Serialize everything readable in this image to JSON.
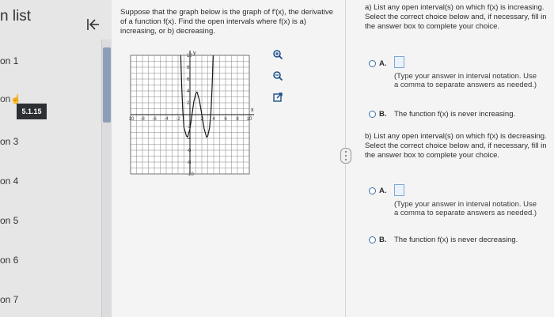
{
  "sidebar": {
    "heading": "n list",
    "items": [
      {
        "label": "on 1"
      },
      {
        "label": "on 3"
      },
      {
        "label": "on 4"
      },
      {
        "label": "on 5"
      },
      {
        "label": "on 6"
      },
      {
        "label": "on 7"
      }
    ],
    "current_prefix": "on",
    "current_badge": "5.1.15",
    "collapse_icon": "collapse-left-icon"
  },
  "question": {
    "text": "Suppose that the graph below is the graph of f′(x), the derivative of a function f(x). Find the open intervals where f(x) is a) increasing, or b) decreasing."
  },
  "graph": {
    "x_label": "x",
    "y_label": "y",
    "x_ticks": [
      "-10",
      "-8",
      "-6",
      "-4",
      "-2",
      "2",
      "4",
      "6",
      "8",
      "10"
    ],
    "y_ticks": [
      "10",
      "8",
      "6",
      "4",
      "2",
      "-2",
      "-4",
      "-6",
      "-8",
      "-10"
    ],
    "xlim": [
      -10,
      10
    ],
    "ylim": [
      -10,
      10
    ],
    "curve": [
      [
        -1.55,
        10
      ],
      [
        -1.4,
        5
      ],
      [
        -1.2,
        0.5
      ],
      [
        -1.0,
        -2.2
      ],
      [
        -0.6,
        -3.6
      ],
      [
        -0.4,
        -3.8
      ],
      [
        0,
        -2.4
      ],
      [
        0.35,
        0
      ],
      [
        0.65,
        2.2
      ],
      [
        1.0,
        3.6
      ],
      [
        1.2,
        3.8
      ],
      [
        1.6,
        2.4
      ],
      [
        2.0,
        0
      ],
      [
        2.4,
        -2.4
      ],
      [
        2.8,
        -3.8
      ],
      [
        3.0,
        -3.6
      ],
      [
        3.3,
        -2.2
      ],
      [
        3.55,
        0.5
      ],
      [
        3.75,
        5
      ],
      [
        3.9,
        10
      ]
    ]
  },
  "tools": {
    "zoom_in_icon": "zoom-in-icon",
    "zoom_out_icon": "zoom-out-icon",
    "new_window_icon": "external-link-icon"
  },
  "part_a": {
    "prompt": "a) List any open interval(s) on which f(x) is increasing. Select the correct choice below and, if necessary, fill in the answer box to complete your choice.",
    "choice_a_letter": "A.",
    "choice_a_hint": "(Type your answer in interval notation. Use a comma to separate answers as needed.)",
    "choice_b_letter": "B.",
    "choice_b_text": "The function f(x) is never increasing."
  },
  "part_b": {
    "prompt": "b) List any open interval(s) on which f(x) is decreasing. Select the correct choice below and, if necessary, fill in the answer box to complete your choice.",
    "choice_a_letter": "A.",
    "choice_a_hint": "(Type your answer in interval notation. Use a comma to separate answers as needed.)",
    "choice_b_letter": "B.",
    "choice_b_text": "The function f(x) is never decreasing."
  },
  "colors": {
    "accent": "#3b6fa8",
    "badge": "#2c2f33"
  }
}
